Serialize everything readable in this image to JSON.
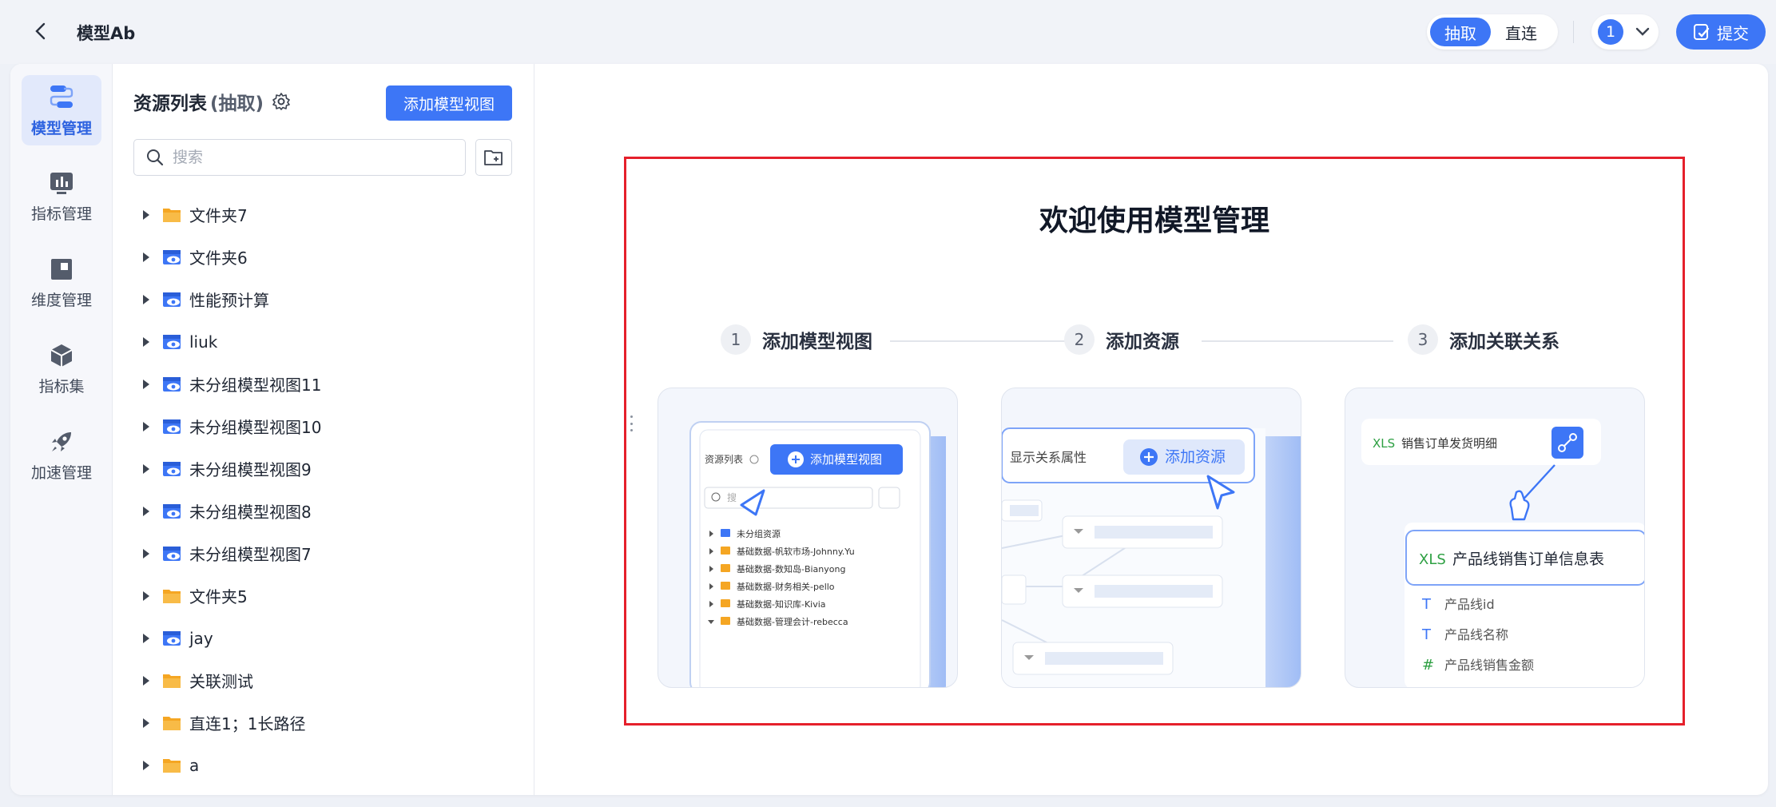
{
  "header": {
    "title": "模型Ab",
    "mode_options": [
      "抽取",
      "直连"
    ],
    "mode_selected": "抽取",
    "version": "1",
    "submit_label": "提交"
  },
  "nav": {
    "items": [
      {
        "label": "模型管理",
        "icon": "model-flow-icon",
        "active": true
      },
      {
        "label": "指标管理",
        "icon": "metric-chart-icon",
        "active": false
      },
      {
        "label": "维度管理",
        "icon": "dimension-icon",
        "active": false
      },
      {
        "label": "指标集",
        "icon": "cube-icon",
        "active": false
      },
      {
        "label": "加速管理",
        "icon": "rocket-icon",
        "active": false
      }
    ]
  },
  "resources": {
    "title": "资源列表",
    "mode": "(抽取)",
    "add_view_label": "添加模型视图",
    "search_placeholder": "搜索",
    "items": [
      {
        "name": "文件夹7",
        "type": "folder"
      },
      {
        "name": "文件夹6",
        "type": "view"
      },
      {
        "name": "性能预计算",
        "type": "view"
      },
      {
        "name": "liuk",
        "type": "view"
      },
      {
        "name": "未分组模型视图11",
        "type": "view"
      },
      {
        "name": "未分组模型视图10",
        "type": "view"
      },
      {
        "name": "未分组模型视图9",
        "type": "view"
      },
      {
        "name": "未分组模型视图8",
        "type": "view"
      },
      {
        "name": "未分组模型视图7",
        "type": "view"
      },
      {
        "name": "文件夹5",
        "type": "folder"
      },
      {
        "name": "jay",
        "type": "view"
      },
      {
        "name": "关联测试",
        "type": "folder"
      },
      {
        "name": "直连1；1长路径",
        "type": "folder"
      },
      {
        "name": "a",
        "type": "folder"
      }
    ]
  },
  "welcome": {
    "title": "欢迎使用模型管理",
    "steps": [
      {
        "num": "1",
        "label": "添加模型视图"
      },
      {
        "num": "2",
        "label": "添加资源"
      },
      {
        "num": "3",
        "label": "添加关联关系"
      }
    ],
    "card1": {
      "panel_title": "资源列表",
      "button": "添加模型视图",
      "search": "搜",
      "items": [
        "未分组资源",
        "基础数据-帆软市场-Johnny.Yu",
        "基础数据-数知岛-Bianyong",
        "基础数据-财务相关-pello",
        "基础数据-知识库-Kivia",
        "基础数据-管理会计-rebecca"
      ]
    },
    "card2": {
      "label": "显示关系属性",
      "button": "添加资源"
    },
    "card3": {
      "small_badge": "XLS",
      "small_table": "销售订单发货明细",
      "big_badge": "XLS",
      "big_table": "产品线销售订单信息表",
      "fields": [
        {
          "kind": "T",
          "name": "产品线id"
        },
        {
          "kind": "T",
          "name": "产品线名称"
        },
        {
          "kind": "#",
          "name": "产品线销售金额"
        }
      ]
    }
  },
  "colors": {
    "accent": "#3d76f6",
    "highlight_border": "#e5202b",
    "folder": "#f5a623",
    "xls_green": "#2ea043"
  }
}
